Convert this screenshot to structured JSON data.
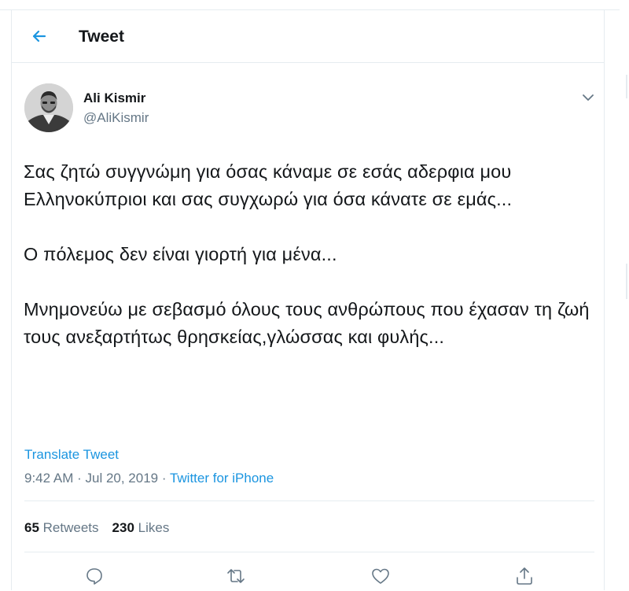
{
  "header": {
    "title": "Tweet"
  },
  "tweet": {
    "author_name": "Ali Kismir",
    "author_handle": "@AliKismir",
    "paragraphs": [
      "Σας ζητώ συγγνώμη για όσας κάναμε σε εσάς αδερφια μου Ελληνοκύπριοι και σας συγχωρώ για όσα κάνατε σε εμάς...",
      "Ο πόλεμος δεν είναι γιορτή για μένα...",
      "Μνημονεύω με σεβασμό όλους τους ανθρώπους που έχασαν τη ζωή τους ανεξαρτήτως θρησκείας,γλώσσας και φυλής..."
    ],
    "translate_label": "Translate Tweet",
    "time": "9:42 AM",
    "separator1": " · ",
    "date": "Jul 20, 2019",
    "separator2": " · ",
    "source": "Twitter for iPhone"
  },
  "stats": {
    "retweets_count": "65",
    "retweets_label": "Retweets",
    "likes_count": "230",
    "likes_label": "Likes"
  },
  "icons": {
    "back": "arrow-left-icon",
    "caret": "chevron-down-icon",
    "reply": "reply-icon",
    "retweet": "retweet-icon",
    "like": "heart-icon",
    "share": "share-icon"
  },
  "colors": {
    "accent": "#1b95e0",
    "secondary_text": "#657786",
    "border": "#e6ecf0",
    "primary_text": "#14171a"
  }
}
